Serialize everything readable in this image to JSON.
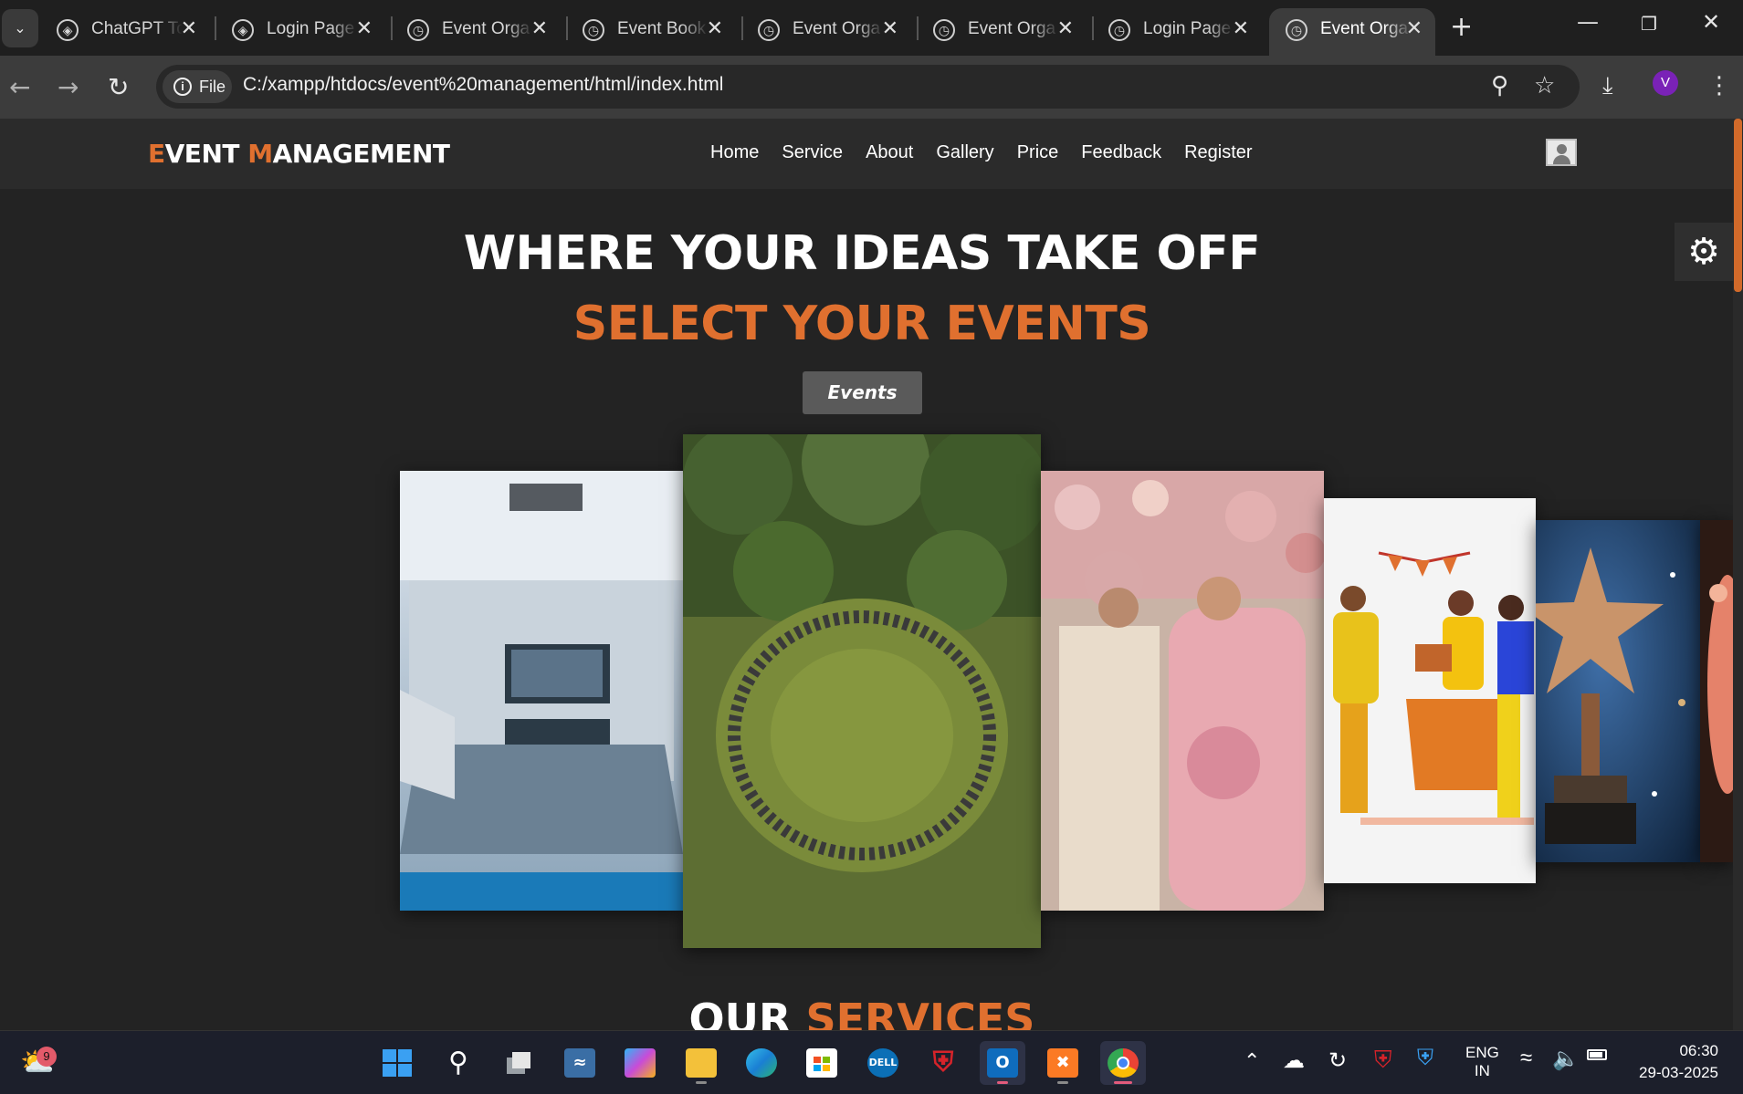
{
  "browser": {
    "tabs": [
      {
        "title": "ChatGPT To",
        "icon": "openai-icon"
      },
      {
        "title": "Login Page",
        "icon": "openai-icon"
      },
      {
        "title": "Event Orga",
        "icon": "globe-icon"
      },
      {
        "title": "Event Book",
        "icon": "globe-icon"
      },
      {
        "title": "Event Orga",
        "icon": "globe-icon"
      },
      {
        "title": "Event Orga",
        "icon": "globe-icon"
      },
      {
        "title": "Login Page",
        "icon": "globe-icon"
      },
      {
        "title": "Event Orga",
        "icon": "globe-icon",
        "active": true
      }
    ],
    "address": {
      "chip": "File",
      "url": "C:/xampp/htdocs/event%20management/html/index.html"
    },
    "profile_initial": "V"
  },
  "site": {
    "logo": {
      "e": "E",
      "vent": "VENT ",
      "m": "M",
      "anagement": "ANAGEMENT"
    },
    "nav": [
      "Home",
      "Service",
      "About",
      "Gallery",
      "Price",
      "Feedback",
      "Register"
    ],
    "hero_title": "WHERE YOUR IDEAS TAKE OFF",
    "hero_subtitle": "SELECT YOUR EVENTS",
    "events_button": "Events",
    "gallery": [
      "conference-room-photo",
      "outdoor-circle-gathering-photo",
      "wedding-couple-photo",
      "birthday-party-illustration",
      "award-trophy-photo",
      "partial-event-photo"
    ],
    "services_heading": {
      "our": "OUR ",
      "services": "SERVICES"
    },
    "accent_color": "#e0702f"
  },
  "taskbar": {
    "weather_badge": "9",
    "language": {
      "line1": "ENG",
      "line2": "IN"
    },
    "time": "06:30",
    "date": "29-03-2025"
  }
}
